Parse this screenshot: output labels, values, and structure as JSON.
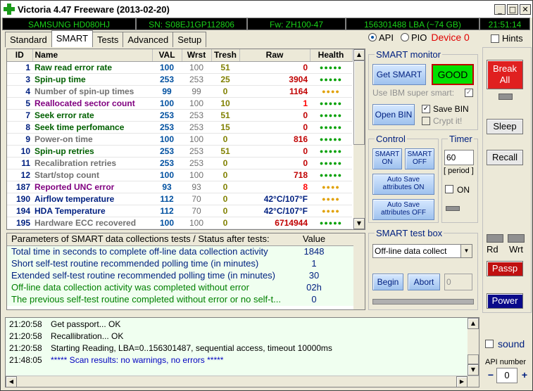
{
  "window": {
    "title": "Victoria 4.47  Freeware (2013-02-20)",
    "min": "_",
    "max": "□",
    "close": "✕"
  },
  "info": {
    "model": "SAMSUNG HD080HJ",
    "serial": "SN: S08EJ1GP112806",
    "firmware": "Fw: ZH100-47",
    "lba": "156301488 LBA (~74 GB)",
    "time": "21:51:14"
  },
  "tabs": [
    "Standard",
    "SMART",
    "Tests",
    "Advanced",
    "Setup"
  ],
  "mode": {
    "api": "API",
    "pio": "PIO",
    "device": "Device 0",
    "hints": "Hints"
  },
  "smart_table": {
    "headers": [
      "ID",
      "Name",
      "VAL",
      "Wrst",
      "Tresh",
      "Raw",
      "Health"
    ],
    "rows": [
      {
        "id": "1",
        "name": "Raw read error rate",
        "val": "100",
        "wrst": "100",
        "tresh": "51",
        "raw": "0",
        "health": "●●●●●",
        "name_color": "#006000",
        "raw_color": "#c00000",
        "health_color": "#00a000"
      },
      {
        "id": "3",
        "name": "Spin-up time",
        "val": "253",
        "wrst": "253",
        "tresh": "25",
        "raw": "3904",
        "health": "●●●●●",
        "name_color": "#006000",
        "raw_color": "#c00000",
        "health_color": "#00a000"
      },
      {
        "id": "4",
        "name": "Number of spin-up times",
        "val": "99",
        "wrst": "99",
        "tresh": "0",
        "raw": "1164",
        "health": "●●●●",
        "name_color": "#707070",
        "raw_color": "#c00000",
        "health_color": "#e0a000"
      },
      {
        "id": "5",
        "name": "Reallocated sector count",
        "val": "100",
        "wrst": "100",
        "tresh": "10",
        "raw": "1",
        "health": "●●●●●",
        "name_color": "#800080",
        "raw_color": "#ff0000",
        "health_color": "#00a000"
      },
      {
        "id": "7",
        "name": "Seek error rate",
        "val": "253",
        "wrst": "253",
        "tresh": "51",
        "raw": "0",
        "health": "●●●●●",
        "name_color": "#006000",
        "raw_color": "#c00000",
        "health_color": "#00a000"
      },
      {
        "id": "8",
        "name": "Seek time perfomance",
        "val": "253",
        "wrst": "253",
        "tresh": "15",
        "raw": "0",
        "health": "●●●●●",
        "name_color": "#006000",
        "raw_color": "#c00000",
        "health_color": "#00a000"
      },
      {
        "id": "9",
        "name": "Power-on time",
        "val": "100",
        "wrst": "100",
        "tresh": "0",
        "raw": "816",
        "health": "●●●●●",
        "name_color": "#707070",
        "raw_color": "#c00000",
        "health_color": "#00a000"
      },
      {
        "id": "10",
        "name": "Spin-up retries",
        "val": "253",
        "wrst": "253",
        "tresh": "51",
        "raw": "0",
        "health": "●●●●●",
        "name_color": "#006000",
        "raw_color": "#c00000",
        "health_color": "#00a000"
      },
      {
        "id": "11",
        "name": "Recalibration retries",
        "val": "253",
        "wrst": "253",
        "tresh": "0",
        "raw": "0",
        "health": "●●●●●",
        "name_color": "#707070",
        "raw_color": "#c00000",
        "health_color": "#00a000"
      },
      {
        "id": "12",
        "name": "Start/stop count",
        "val": "100",
        "wrst": "100",
        "tresh": "0",
        "raw": "718",
        "health": "●●●●●",
        "name_color": "#707070",
        "raw_color": "#c00000",
        "health_color": "#00a000"
      },
      {
        "id": "187",
        "name": "Reported UNC error",
        "val": "93",
        "wrst": "93",
        "tresh": "0",
        "raw": "8",
        "health": "●●●●",
        "name_color": "#800080",
        "raw_color": "#ff0000",
        "health_color": "#e0a000"
      },
      {
        "id": "190",
        "name": "Airflow temperature",
        "val": "112",
        "wrst": "70",
        "tresh": "0",
        "raw": "42°C/107°F",
        "health": "●●●●",
        "name_color": "#002080",
        "raw_color": "#002080",
        "health_color": "#e0a000"
      },
      {
        "id": "194",
        "name": "HDA Temperature",
        "val": "112",
        "wrst": "70",
        "tresh": "0",
        "raw": "42°C/107°F",
        "health": "●●●●",
        "name_color": "#002080",
        "raw_color": "#002080",
        "health_color": "#e0a000"
      },
      {
        "id": "195",
        "name": "Hardware ECC recovered",
        "val": "100",
        "wrst": "100",
        "tresh": "0",
        "raw": "6714944",
        "health": "●●●●●",
        "name_color": "#707070",
        "raw_color": "#c00000",
        "health_color": "#00a000"
      }
    ]
  },
  "params": {
    "header_name": "Parameters of SMART data collections tests / Status after tests:",
    "header_value": "Value",
    "rows": [
      {
        "name": "Total time in seconds to complete off-line data collection activity",
        "value": "1848",
        "color": "#002080"
      },
      {
        "name": "Short self-test routine recommended polling time (in minutes)",
        "value": "1",
        "color": "#002080"
      },
      {
        "name": "Extended self-test routine recommended polling time (in minutes)",
        "value": "30",
        "color": "#002080"
      },
      {
        "name": "Off-line data collection activity was completed without error",
        "value": "02h",
        "color": "#008000"
      },
      {
        "name": "The previous self-test routine completed without error or no self-t...",
        "value": "0",
        "color": "#008000"
      }
    ]
  },
  "smart_monitor": {
    "label": "SMART monitor",
    "get_smart": "Get SMART",
    "status": "GOOD",
    "ibm": "Use IBM super smart:",
    "open_bin": "Open BIN",
    "save_bin": "Save BIN",
    "crypt": "Crypt it!"
  },
  "control": {
    "label": "Control",
    "smart_on": "SMART ON",
    "smart_off": "SMART OFF",
    "auto_on": "Auto Save attributes ON",
    "auto_off": "Auto Save attributes OFF"
  },
  "timer": {
    "label": "Timer",
    "value": "60",
    "period": "[ period ]",
    "on": "ON"
  },
  "testbox": {
    "label": "SMART test box",
    "selected": "Off-line data collect",
    "begin": "Begin",
    "abort": "Abort",
    "field": "0"
  },
  "right": {
    "break": "Break All",
    "sleep": "Sleep",
    "recall": "Recall",
    "rd": "Rd",
    "wrt": "Wrt",
    "passp": "Passp",
    "power": "Power",
    "sound": "sound",
    "api_label": "API number",
    "api_value": "0",
    "minus": "−",
    "plus": "+"
  },
  "log": [
    {
      "time": "21:20:58",
      "msg": "Get passport... OK",
      "color": "#000000"
    },
    {
      "time": "21:20:58",
      "msg": "Recallibration... OK",
      "color": "#000000"
    },
    {
      "time": "21:20:58",
      "msg": "Starting Reading, LBA=0..156301487, sequential access, timeout 10000ms",
      "color": "#000000"
    },
    {
      "time": "21:48:05",
      "msg": "***** Scan results: no warnings, no errors *****",
      "color": "#0000c0"
    }
  ]
}
